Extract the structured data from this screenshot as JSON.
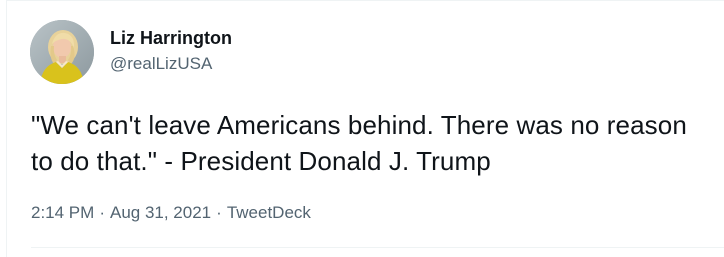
{
  "tweet": {
    "author": {
      "name": "Liz Harrington",
      "handle": "@realLizUSA",
      "avatar_icon": "profile-photo"
    },
    "text": "\"We can't leave Americans behind. There was no reason to do that.\" - President Donald J. Trump",
    "meta": {
      "time": "2:14 PM",
      "separator": "·",
      "date": "Aug 31, 2021",
      "source": "TweetDeck"
    }
  },
  "colors": {
    "text_primary": "#0f1419",
    "text_secondary": "#536471",
    "border": "#eff3f4"
  }
}
